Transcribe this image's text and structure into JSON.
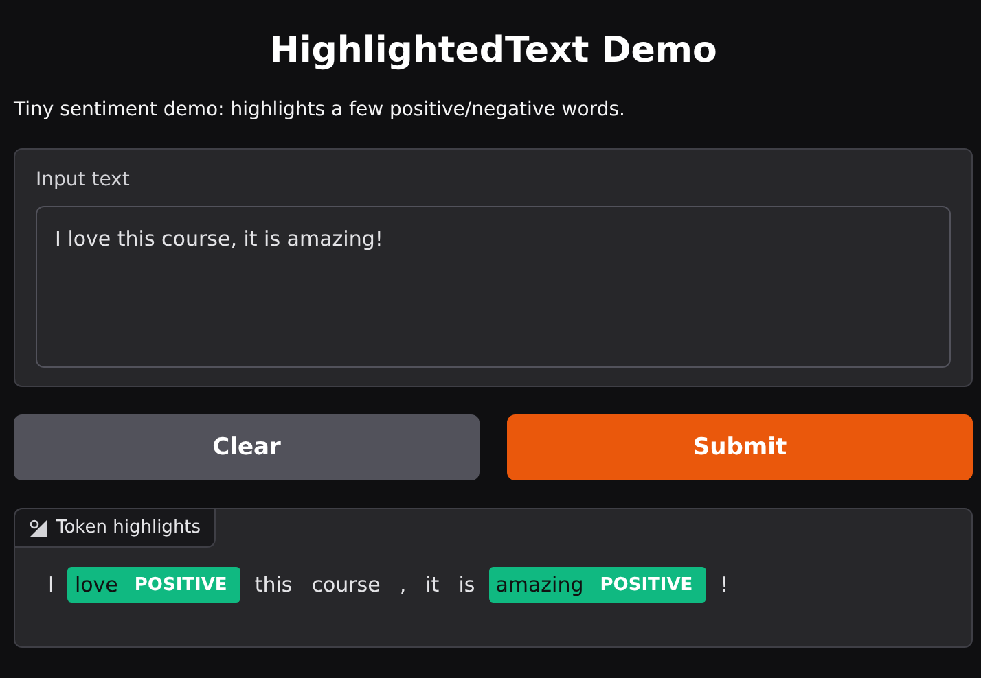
{
  "title": "HighlightedText Demo",
  "description": "Tiny sentiment demo: highlights a few positive/negative words.",
  "input": {
    "label": "Input text",
    "value": "I love this course, it is amazing!"
  },
  "buttons": [
    {
      "label": "Clear",
      "kind": "secondary"
    },
    {
      "label": "Submit",
      "kind": "primary"
    }
  ],
  "output": {
    "label": "Token highlights",
    "tokens": [
      {
        "text": "I"
      },
      {
        "text": "love",
        "label": "POSITIVE",
        "color": "#10b981"
      },
      {
        "text": "this"
      },
      {
        "text": "course"
      },
      {
        "text": ","
      },
      {
        "text": "it"
      },
      {
        "text": "is"
      },
      {
        "text": "amazing",
        "label": "POSITIVE",
        "color": "#10b981"
      },
      {
        "text": "!"
      }
    ]
  }
}
